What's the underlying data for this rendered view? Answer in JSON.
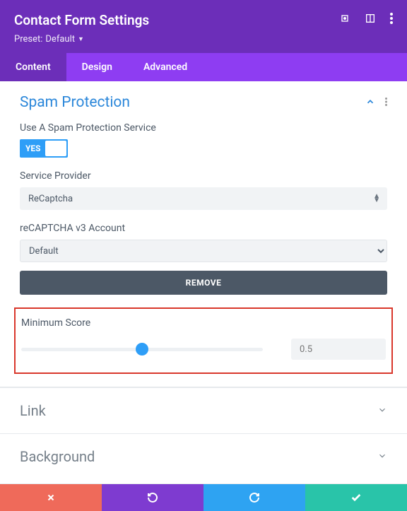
{
  "header": {
    "title": "Contact Form Settings",
    "preset_label": "Preset:",
    "preset_value": "Default"
  },
  "tabs": [
    "Content",
    "Design",
    "Advanced"
  ],
  "active_tab": 0,
  "spam": {
    "title": "Spam Protection",
    "use_service_label": "Use A Spam Protection Service",
    "toggle_on_text": "YES",
    "provider_label": "Service Provider",
    "provider_value": "ReCaptcha",
    "account_label": "reCAPTCHA v3 Account",
    "account_value": "Default",
    "remove_label": "REMOVE",
    "min_score_label": "Minimum Score",
    "min_score_value": "0.5",
    "min_score_pct": 50
  },
  "sections": {
    "link": "Link",
    "background": "Background"
  }
}
